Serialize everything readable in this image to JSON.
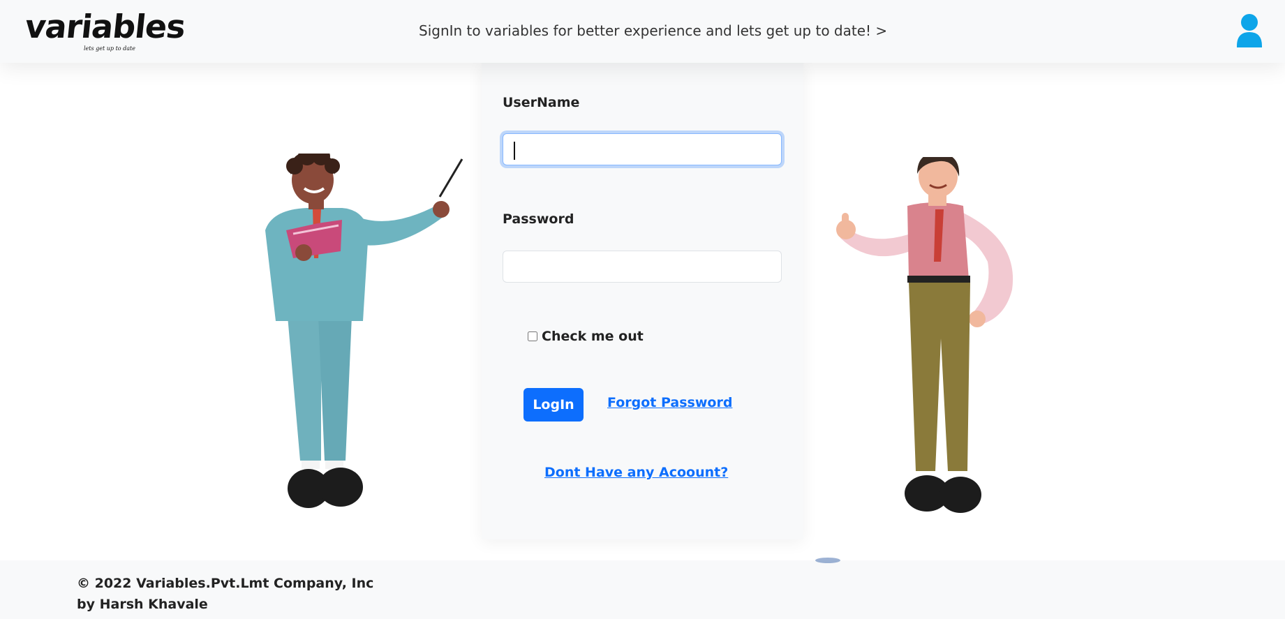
{
  "header": {
    "logo_text": "variables",
    "logo_tagline": "lets get up to date",
    "message": "SignIn to variables for better experience and lets get up to date! >",
    "user_icon": "user-icon"
  },
  "login_form": {
    "username_label": "UserName",
    "username_value": "",
    "password_label": "Password",
    "password_value": "",
    "checkbox_label": "Check me out",
    "checkbox_checked": false,
    "login_button": "LogIn",
    "forgot_link": "Forgot Password",
    "signup_link": "Dont Have any Acoount?"
  },
  "illustrations": {
    "left": "teacher-figure",
    "right": "thumbs-up-figure"
  },
  "footer": {
    "copyright": "© 2022 Variables.Pvt.Lmt Company, Inc",
    "author": "by Harsh Khavale"
  },
  "colors": {
    "primary": "#0d6efd",
    "user_icon": "#0ea5e9",
    "background": "#f8f9fa"
  }
}
